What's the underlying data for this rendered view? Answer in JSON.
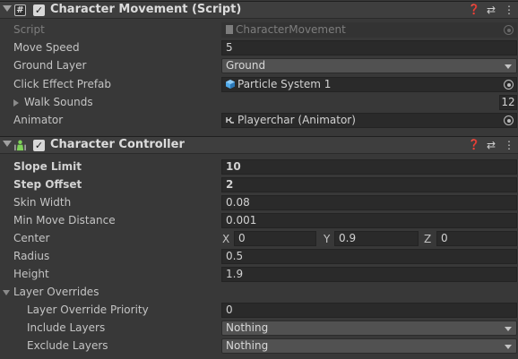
{
  "script_component": {
    "title": "Character Movement (Script)",
    "icon": "hash-script-icon",
    "help_icon": "❓",
    "presets_icon": "⇄",
    "menu_icon": "⋮",
    "fields": {
      "script": {
        "label": "Script",
        "value": "CharacterMovement"
      },
      "move_speed": {
        "label": "Move Speed",
        "value": "5"
      },
      "ground_layer": {
        "label": "Ground Layer",
        "value": "Ground"
      },
      "click_effect_prefab": {
        "label": "Click Effect Prefab",
        "value": "Particle System 1"
      },
      "walk_sounds": {
        "label": "Walk Sounds",
        "count": "12"
      },
      "animator": {
        "label": "Animator",
        "value": "Playerchar (Animator)"
      }
    }
  },
  "controller_component": {
    "title": "Character Controller",
    "icon": "character-controller-icon",
    "fields": {
      "slope_limit": {
        "label": "Slope Limit",
        "value": "10"
      },
      "step_offset": {
        "label": "Step Offset",
        "value": "2"
      },
      "skin_width": {
        "label": "Skin Width",
        "value": "0.08"
      },
      "min_move_distance": {
        "label": "Min Move Distance",
        "value": "0.001"
      },
      "center": {
        "label": "Center",
        "x_label": "X",
        "x": "0",
        "y_label": "Y",
        "y": "0.9",
        "z_label": "Z",
        "z": "0"
      },
      "radius": {
        "label": "Radius",
        "value": "0.5"
      },
      "height": {
        "label": "Height",
        "value": "1.9"
      }
    },
    "layer_overrides": {
      "label": "Layer Overrides",
      "priority": {
        "label": "Layer Override Priority",
        "value": "0"
      },
      "include_layers": {
        "label": "Include Layers",
        "value": "Nothing"
      },
      "exclude_layers": {
        "label": "Exclude Layers",
        "value": "Nothing"
      }
    }
  },
  "colors": {
    "panel_bg": "#383838",
    "header_bg": "#3e3e3e",
    "field_bg": "#2a2a2a",
    "dropdown_bg": "#515151",
    "text": "#c4c4c4",
    "controller_icon": "#7fd35a",
    "particle_icon": "#4fa8e8"
  }
}
